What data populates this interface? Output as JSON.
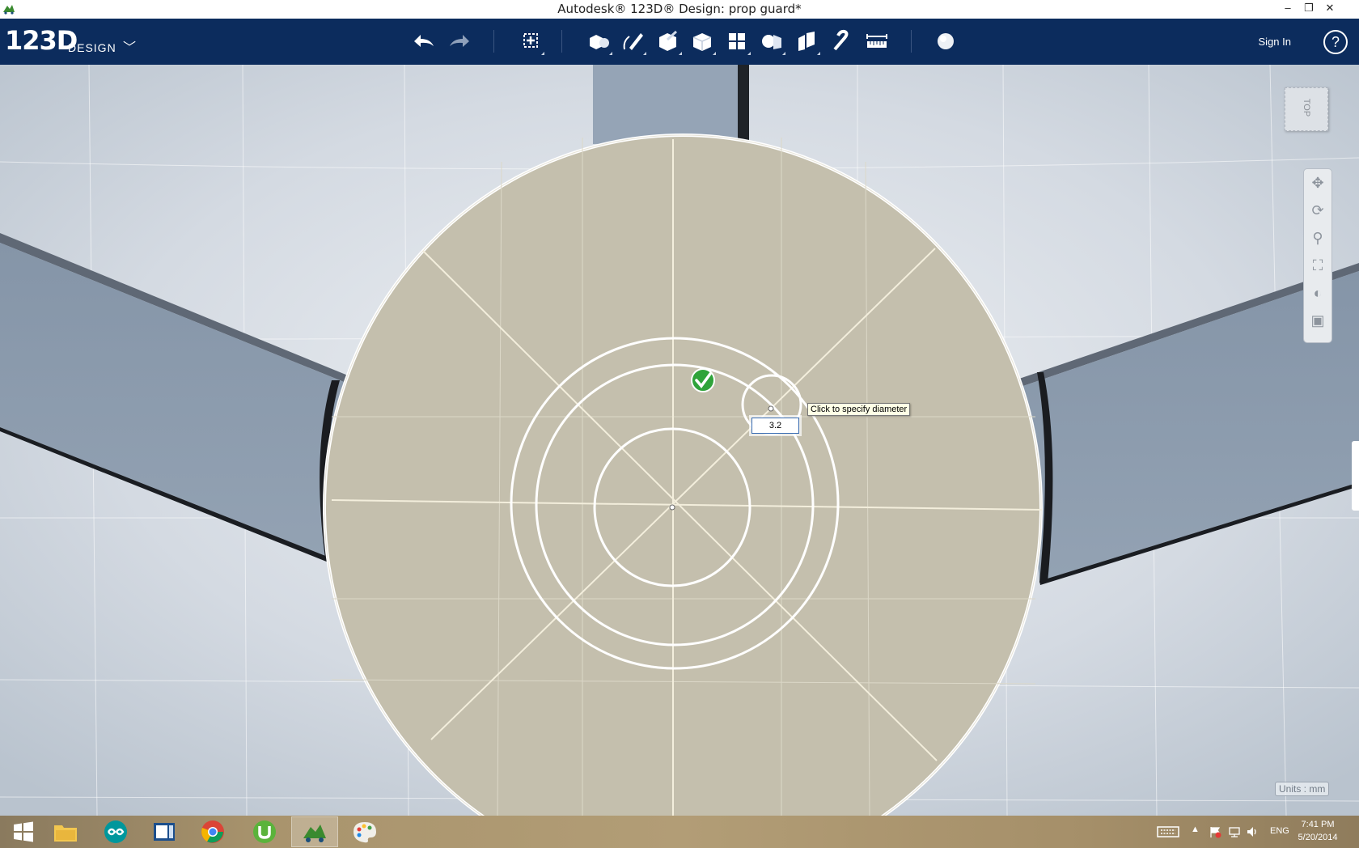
{
  "window": {
    "title": "Autodesk® 123D® Design: prop guard*",
    "minimize": "–",
    "restore": "❐",
    "close": "✕"
  },
  "toolbar": {
    "logo_num": "123D",
    "logo_text": "DESIGN",
    "logo_chevron": "﹀",
    "sign_in": "Sign In",
    "help": "?",
    "tools": [
      "undo",
      "redo",
      "transform",
      "primitives",
      "sketch",
      "construct",
      "modify",
      "pattern",
      "grouping",
      "combine",
      "measure-snap",
      "material"
    ]
  },
  "viewport": {
    "tooltip": "Click to specify diameter",
    "diameter_value": "3.2",
    "viewcube_label": "TOP",
    "units": "Units : mm",
    "nav_tools": [
      "pan",
      "orbit",
      "zoom",
      "fit",
      "view-mode",
      "material-view"
    ]
  },
  "taskbar": {
    "apps": [
      "start",
      "file-explorer",
      "arduino",
      "notepad",
      "chrome",
      "utorrent",
      "123d-design",
      "paint"
    ],
    "language": "ENG",
    "time": "7:41 PM",
    "date": "5/20/2014"
  },
  "colors": {
    "toolbar_bg": "#0c2c5d",
    "viewport_bg": "#c9d2dc",
    "disk_fill": "#c4bfad",
    "sketch_line": "#ffffff",
    "check_green": "#2fa33a"
  }
}
